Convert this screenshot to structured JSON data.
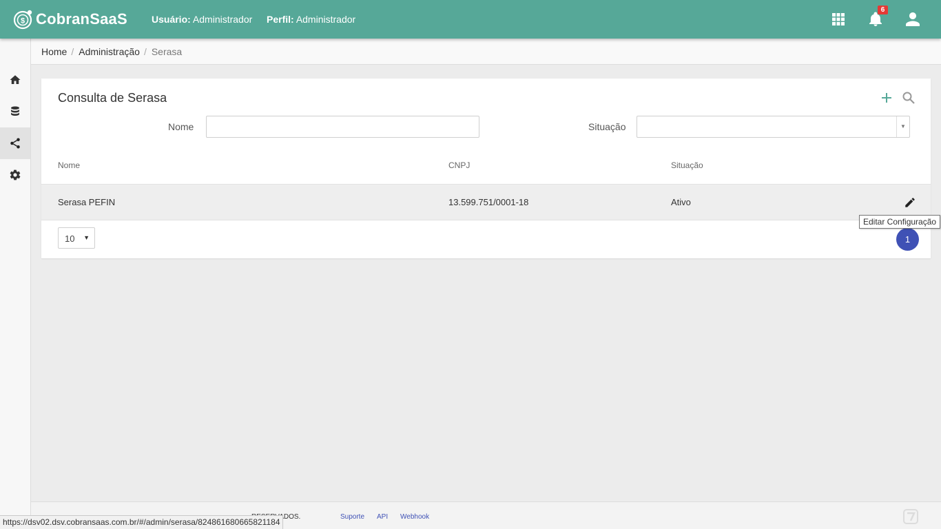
{
  "header": {
    "brand": "CobranSaaS",
    "user_label": "Usuário:",
    "user_value": "Administrador",
    "profile_label": "Perfil:",
    "profile_value": "Administrador",
    "notification_count": "6",
    "colors": {
      "primary": "#56a898",
      "badge": "#e53935"
    }
  },
  "sidebar": {
    "items": [
      {
        "icon": "home-icon"
      },
      {
        "icon": "database-icon"
      },
      {
        "icon": "share-icon",
        "active": true
      },
      {
        "icon": "gear-icon"
      }
    ]
  },
  "breadcrumb": {
    "home": "Home",
    "admin": "Administração",
    "current": "Serasa",
    "separator": "/"
  },
  "panel": {
    "title": "Consulta de Serasa",
    "filters": {
      "nome_label": "Nome",
      "nome_value": "",
      "situacao_label": "Situação",
      "situacao_value": ""
    },
    "table": {
      "columns": [
        "Nome",
        "CNPJ",
        "Situação"
      ],
      "rows": [
        {
          "nome": "Serasa PEFIN",
          "cnpj": "13.599.751/0001-18",
          "situacao": "Ativo"
        }
      ]
    },
    "page_size": "10",
    "page_size_arrow": "▼",
    "current_page": "1",
    "pagination_color": "#3f51b5"
  },
  "tooltip": "Editar Configuração",
  "footer": {
    "copyright_fragment": "RESERVADOS.",
    "links": [
      "Suporte",
      "API",
      "Webhook"
    ],
    "link_color": "#3f51b5"
  },
  "statusbar_url": "https://dsv02.dsv.cobransaas.com.br/#/admin/serasa/824861680665821184"
}
